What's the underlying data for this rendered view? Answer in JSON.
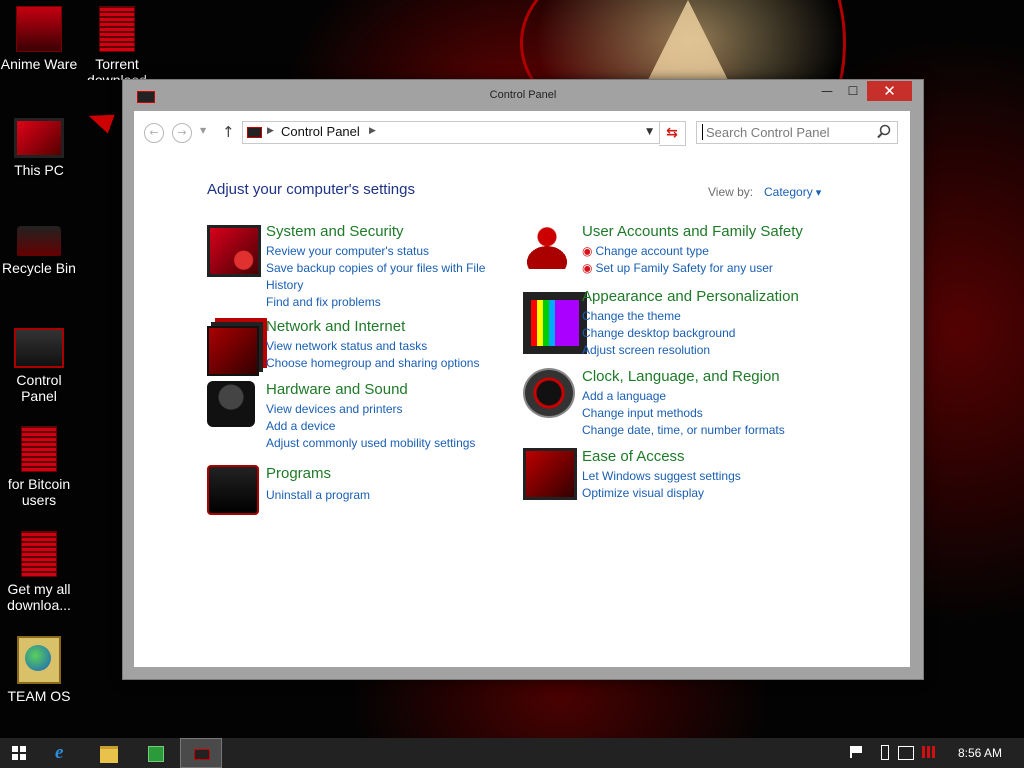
{
  "desktop": {
    "icons": [
      {
        "label": "Anime Ware"
      },
      {
        "label": "Torrent downlaod"
      },
      {
        "label": "This PC"
      },
      {
        "label": "Recycle Bin"
      },
      {
        "label": "Control Panel"
      },
      {
        "label": "for Bitcoin users"
      },
      {
        "label": "Get my all downloa..."
      },
      {
        "label": "TEAM OS"
      }
    ]
  },
  "window": {
    "title": "Control Panel",
    "controls": {
      "minimize": "—",
      "maximize": "☐",
      "close": "✕"
    }
  },
  "address_bar": {
    "crumb": "Control Panel",
    "search_placeholder": "Search Control Panel"
  },
  "content": {
    "heading": "Adjust your computer's settings",
    "view_by_label": "View by:",
    "view_by_value": "Category",
    "categories": [
      {
        "title": "System and Security",
        "icon": "shield-monitor-icon",
        "links": [
          "Review your computer's status",
          "Save backup copies of your files with File History",
          "Find and fix problems"
        ]
      },
      {
        "title": "Network and Internet",
        "icon": "network-icon",
        "links": [
          "View network status and tasks",
          "Choose homegroup and sharing options"
        ]
      },
      {
        "title": "Hardware and Sound",
        "icon": "hardware-icon",
        "links": [
          "View devices and printers",
          "Add a device",
          "Adjust commonly used mobility settings"
        ]
      },
      {
        "title": "Programs",
        "icon": "programs-icon",
        "links": [
          "Uninstall a program"
        ]
      },
      {
        "title": "User Accounts and Family Safety",
        "icon": "user-accounts-icon",
        "links": [
          "Change account type",
          "Set up Family Safety for any user"
        ]
      },
      {
        "title": "Appearance and Personalization",
        "icon": "appearance-icon",
        "links": [
          "Change the theme",
          "Change desktop background",
          "Adjust screen resolution"
        ]
      },
      {
        "title": "Clock, Language, and Region",
        "icon": "clock-icon",
        "links": [
          "Add a language",
          "Change input methods",
          "Change date, time, or number formats"
        ]
      },
      {
        "title": "Ease of Access",
        "icon": "ease-of-access-icon",
        "links": [
          "Let Windows suggest settings",
          "Optimize visual display"
        ]
      }
    ]
  },
  "taskbar": {
    "items": [
      "start-icon",
      "internet-explorer-icon",
      "file-explorer-icon",
      "store-icon",
      "control-panel-icon"
    ],
    "tray": [
      "flag-icon",
      "battery-icon",
      "network-icon",
      "signal-icon"
    ],
    "clock": "8:56 AM"
  }
}
